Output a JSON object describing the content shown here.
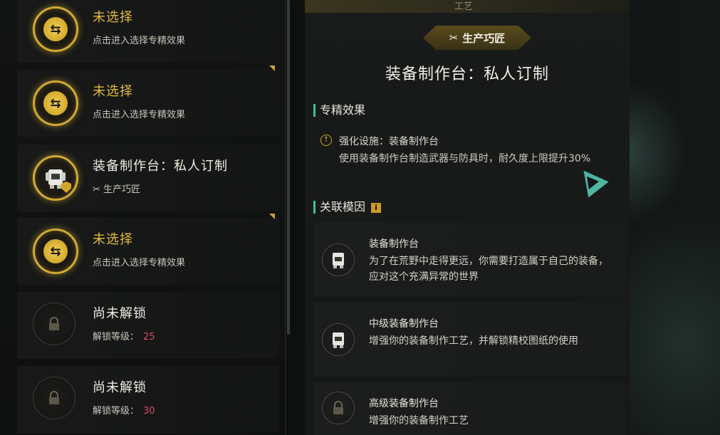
{
  "left_list": {
    "items": [
      {
        "title": "未选择",
        "sub": "点击进入选择专精效果"
      },
      {
        "title": "未选择",
        "sub": "点击进入选择专精效果"
      },
      {
        "title": "装备制作台：私人订制",
        "tag": "生产巧匠"
      },
      {
        "title": "未选择",
        "sub": "点击进入选择专精效果"
      },
      {
        "title": "尚未解锁",
        "unlock_label": "解锁等级：",
        "unlock_level": "25"
      },
      {
        "title": "尚未解锁",
        "unlock_label": "解锁等级：",
        "unlock_level": "30"
      }
    ]
  },
  "detail": {
    "top_label": "工艺",
    "tag": "生产巧匠",
    "title": "装备制作台：私人订制",
    "specialty_header": "专精效果",
    "effect_name": "强化设施：装备制作台",
    "effect_desc": "使用装备制作台制造武器与防具时，耐久度上限提升30%",
    "related_header": "关联模因",
    "modules": [
      {
        "name": "装备制作台",
        "desc": "为了在荒野中走得更远，你需要打造属于自己的装备，应对这个充满异常的世界"
      },
      {
        "name": "中级装备制作台",
        "desc": "增强你的装备制作工艺，并解锁精校图纸的使用"
      },
      {
        "name": "高级装备制作台",
        "desc": "增强你的装备制作工艺"
      }
    ]
  },
  "colors": {
    "gold": "#e2bb3c",
    "accent": "#3fbf9a",
    "level": "#d24d66"
  }
}
